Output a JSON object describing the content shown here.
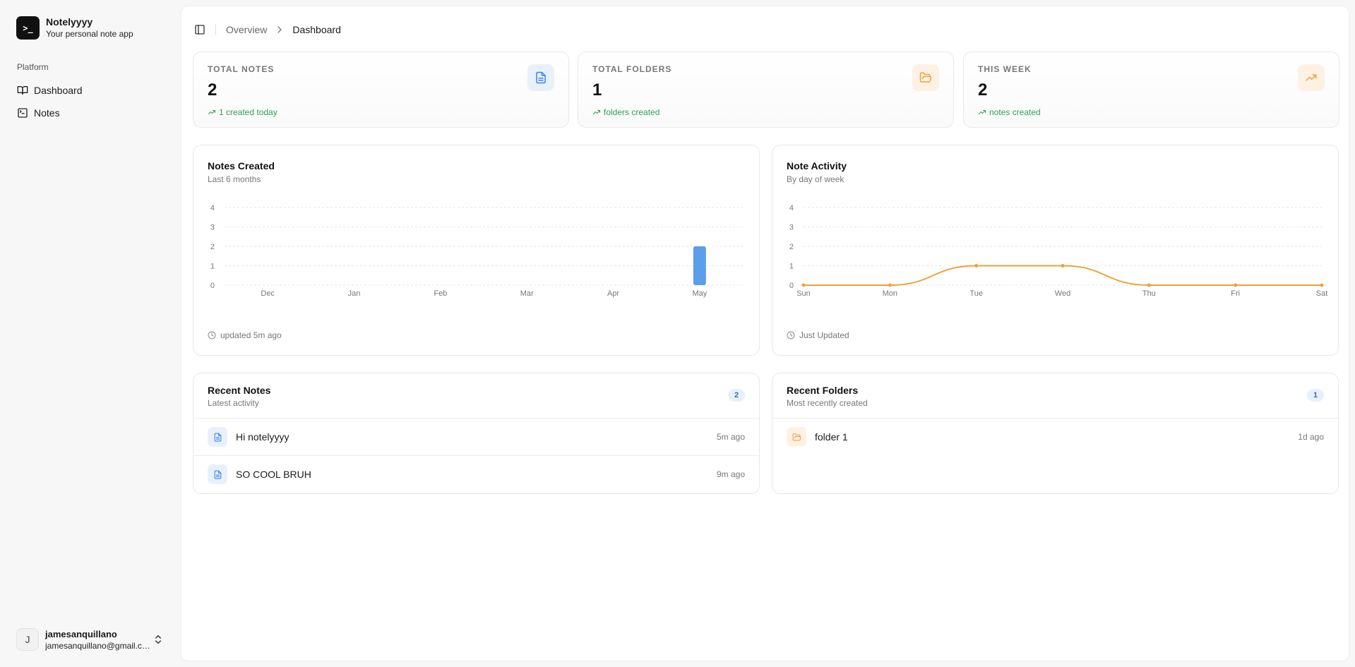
{
  "brand": {
    "name": "Notelyyyy",
    "subtitle": "Your personal note app",
    "logo_glyph": ">_"
  },
  "sidebar": {
    "group_label": "Platform",
    "items": [
      {
        "label": "Dashboard",
        "icon": "book-open-icon"
      },
      {
        "label": "Notes",
        "icon": "terminal-square-icon"
      }
    ]
  },
  "user": {
    "initial": "J",
    "name": "jamesanquillano",
    "email": "jamesanquillano@gmail.com"
  },
  "breadcrumb": {
    "parent": "Overview",
    "current": "Dashboard"
  },
  "stats": [
    {
      "label": "TOTAL NOTES",
      "value": "2",
      "note": "1 created today",
      "icon": "file-text-icon",
      "accent": "#3b82f6",
      "icon_bg": "#e8f1fb"
    },
    {
      "label": "TOTAL FOLDERS",
      "value": "1",
      "note": "folders created",
      "icon": "folder-open-icon",
      "accent": "#f59e3b",
      "icon_bg": "#fdf1e4"
    },
    {
      "label": "THIS WEEK",
      "value": "2",
      "note": "notes created",
      "icon": "trending-up-icon",
      "accent": "#f59e3b",
      "icon_bg": "#fdf1e4"
    }
  ],
  "charts": {
    "notes_created": {
      "title": "Notes Created",
      "subtitle": "Last 6 months",
      "footer": "updated 5m ago"
    },
    "note_activity": {
      "title": "Note Activity",
      "subtitle": "By day of week",
      "footer": "Just Updated"
    }
  },
  "chart_data": [
    {
      "type": "bar",
      "title": "Notes Created",
      "subtitle": "Last 6 months",
      "categories": [
        "Dec",
        "Jan",
        "Feb",
        "Mar",
        "Apr",
        "May"
      ],
      "values": [
        0,
        0,
        0,
        0,
        0,
        2
      ],
      "yticks": [
        0,
        1,
        2,
        3,
        4
      ],
      "ylim": [
        0,
        4
      ],
      "color": "#5b9ee9",
      "grid": true
    },
    {
      "type": "line",
      "title": "Note Activity",
      "subtitle": "By day of week",
      "categories": [
        "Sun",
        "Mon",
        "Tue",
        "Wed",
        "Thu",
        "Fri",
        "Sat"
      ],
      "values": [
        0,
        0,
        1,
        1,
        0,
        0,
        0
      ],
      "yticks": [
        0,
        1,
        2,
        3,
        4
      ],
      "ylim": [
        0,
        4
      ],
      "color": "#f59e3b",
      "grid": true
    }
  ],
  "recent_notes": {
    "title": "Recent Notes",
    "subtitle": "Latest activity",
    "count": "2",
    "items": [
      {
        "title": "Hi notelyyyy",
        "time": "5m ago"
      },
      {
        "title": "SO COOL BRUH",
        "time": "9m ago"
      }
    ]
  },
  "recent_folders": {
    "title": "Recent Folders",
    "subtitle": "Most recently created",
    "count": "1",
    "items": [
      {
        "title": "folder 1",
        "time": "1d ago"
      }
    ]
  }
}
